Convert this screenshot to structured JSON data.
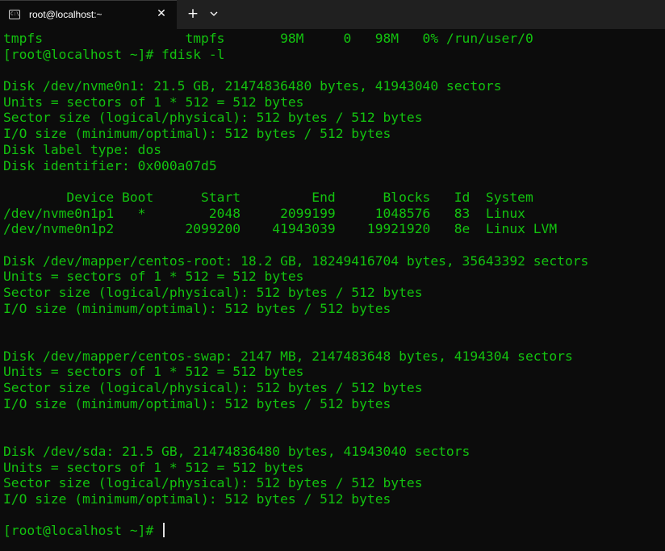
{
  "window": {
    "tab_title": "root@localhost:~",
    "tab_icon": "terminal-icon",
    "close_glyph": "✕",
    "new_tab_glyph": "+"
  },
  "terminal": {
    "lines": [
      "tmpfs                  tmpfs       98M     0   98M   0% /run/user/0",
      "[root@localhost ~]# fdisk -l",
      "",
      "Disk /dev/nvme0n1: 21.5 GB, 21474836480 bytes, 41943040 sectors",
      "Units = sectors of 1 * 512 = 512 bytes",
      "Sector size (logical/physical): 512 bytes / 512 bytes",
      "I/O size (minimum/optimal): 512 bytes / 512 bytes",
      "Disk label type: dos",
      "Disk identifier: 0x000a07d5",
      "",
      "        Device Boot      Start         End      Blocks   Id  System",
      "/dev/nvme0n1p1   *        2048     2099199     1048576   83  Linux",
      "/dev/nvme0n1p2         2099200    41943039    19921920   8e  Linux LVM",
      "",
      "Disk /dev/mapper/centos-root: 18.2 GB, 18249416704 bytes, 35643392 sectors",
      "Units = sectors of 1 * 512 = 512 bytes",
      "Sector size (logical/physical): 512 bytes / 512 bytes",
      "I/O size (minimum/optimal): 512 bytes / 512 bytes",
      "",
      "",
      "Disk /dev/mapper/centos-swap: 2147 MB, 2147483648 bytes, 4194304 sectors",
      "Units = sectors of 1 * 512 = 512 bytes",
      "Sector size (logical/physical): 512 bytes / 512 bytes",
      "I/O size (minimum/optimal): 512 bytes / 512 bytes",
      "",
      "",
      "Disk /dev/sda: 21.5 GB, 21474836480 bytes, 41943040 sectors",
      "Units = sectors of 1 * 512 = 512 bytes",
      "Sector size (logical/physical): 512 bytes / 512 bytes",
      "I/O size (minimum/optimal): 512 bytes / 512 bytes",
      ""
    ],
    "prompt": "[root@localhost ~]# "
  },
  "colors": {
    "terminal_bg": "#0c0c0c",
    "terminal_fg": "#13c20f",
    "titlebar_bg": "#202020"
  }
}
